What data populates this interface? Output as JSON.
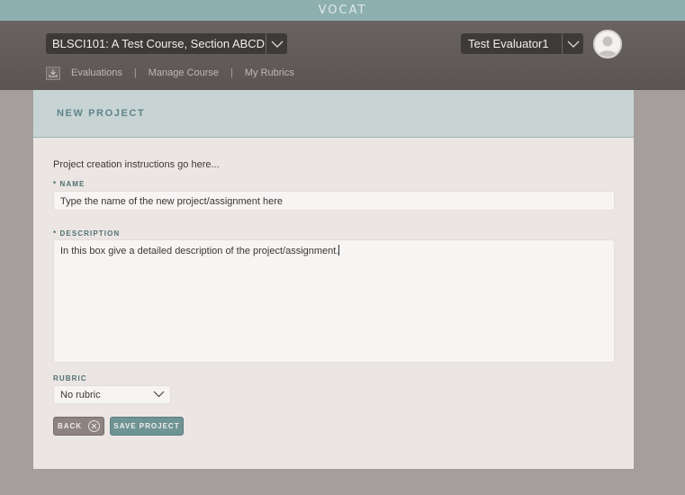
{
  "brand": {
    "name": "VOCAT",
    "color": "#8eafaf"
  },
  "header": {
    "course_select": {
      "value": "BLSCI101: A Test Course, Section ABCD",
      "icon": "chevron-down-icon"
    },
    "user_select": {
      "value": "Test Evaluator1",
      "icon": "chevron-down-icon"
    },
    "avatar": {
      "icon": "user-avatar-icon"
    },
    "nav": {
      "icon": "download-tray-icon",
      "items": [
        {
          "label": "Evaluations"
        },
        {
          "label": "Manage Course"
        },
        {
          "label": "My Rubrics"
        }
      ],
      "separator": "|"
    }
  },
  "panel": {
    "title": "NEW PROJECT",
    "intro": "Project creation instructions go here...",
    "name_field": {
      "label": "* NAME",
      "value": "Type the name of the new project/assignment here"
    },
    "description_field": {
      "label": "* DESCRIPTION",
      "value": "In this box give a detailed description of the project/assignment."
    },
    "rubric_field": {
      "label": "RUBRIC",
      "value": "No rubric",
      "icon": "chevron-down-icon"
    },
    "buttons": {
      "back": "BACK",
      "back_icon": "close-circle-icon",
      "save": "SAVE PROJECT"
    }
  },
  "colors": {
    "accent": "#6f9494",
    "header_bg": "#5f5a58",
    "panel_bg": "#ebe6e4",
    "panel_head_bg": "#c8d4d4"
  }
}
